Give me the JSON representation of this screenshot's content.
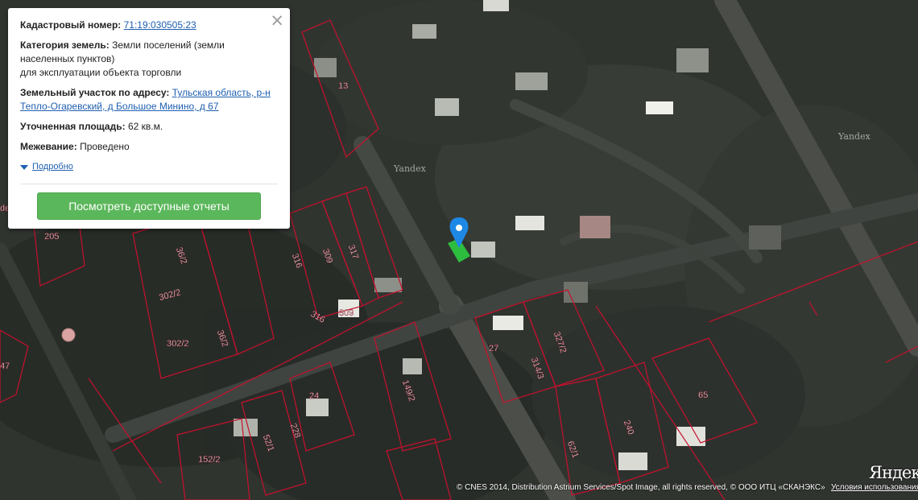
{
  "popup": {
    "cadastral_label": "Кадастровый номер:",
    "cadastral_value": "71:19:030505:23",
    "category_label": "Категория земель:",
    "category_value": "Земли поселений (земли населенных пунктов)",
    "category_use": "для эксплуатации объекта торговли",
    "address_label": "Земельный участок по адресу:",
    "address_value": "Тульская область, р-н Тепло-Огаревский, д Большое Минино, д 67",
    "area_label": "Уточненная площадь:",
    "area_value": "62 кв.м.",
    "survey_label": "Межевание:",
    "survey_value": "Проведено",
    "more_label": "Подробно",
    "button_label": "Посмотреть доступные отчеты",
    "close_symbol": "×"
  },
  "map": {
    "parcel_labels": [
      "13",
      "205",
      "36/2",
      "302/2",
      "302/2",
      "36/2",
      "316",
      "309",
      "317",
      "316",
      "309",
      "27",
      "314/3",
      "327/2",
      "24",
      "149/2",
      "52/1",
      "228",
      "152/2",
      "65",
      "240",
      "62/1",
      "47",
      "de"
    ],
    "watermark": "Yandex",
    "logo": "Яндекс",
    "copyright": "© CNES 2014, Distribution Astrium Services/Spot Image, all rights reserved, © ООО ИТЦ «СКАНЭКС»",
    "terms_link": "Условия использования",
    "colors": {
      "parcel_border": "#c8102e",
      "selected_parcel": "#2ecc40",
      "marker": "#1e88e5",
      "button": "#5bb75b"
    },
    "icons": [
      "location-pin-icon",
      "close-icon",
      "triangle-down-icon"
    ]
  }
}
